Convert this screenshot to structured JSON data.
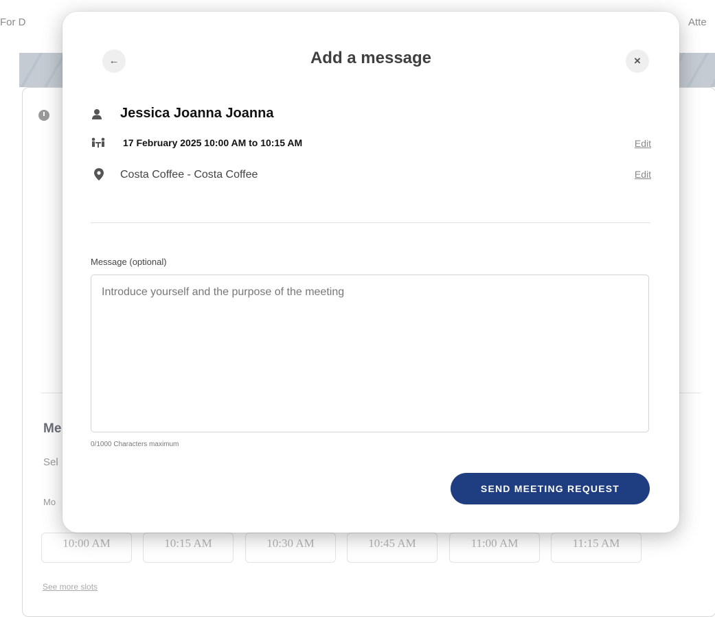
{
  "background": {
    "tab_left": "For D",
    "tab_right": "Atte",
    "heading_partial": "Me",
    "subtext_partial": "Sel",
    "day_partial": "Mo",
    "slots": [
      "10:00 AM",
      "10:15 AM",
      "10:30 AM",
      "10:45 AM",
      "11:00 AM",
      "11:15 AM"
    ],
    "see_more_label": "See more slots"
  },
  "modal": {
    "title": "Add a message",
    "back_icon": "arrow-left-icon",
    "close_icon": "close-icon",
    "attendee_name": "Jessica Joanna Joanna",
    "datetime": "17 February 2025 10:00 AM to 10:15 AM",
    "location": "Costa Coffee - Costa Coffee",
    "edit_label": "Edit",
    "message_label": "Message (optional)",
    "message_value": "",
    "message_placeholder": "Introduce yourself and the purpose of the meeting",
    "counter": "0/1000 Characters maximum",
    "send_label": "SEND MEETING REQUEST",
    "accent_color": "#1f3e82"
  }
}
